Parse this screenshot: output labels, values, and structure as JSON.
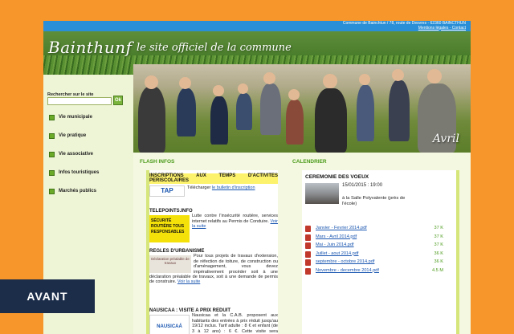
{
  "topbar": {
    "address": "Commune de Bainchtun / 78, route de Desvres - 62360 BAINCTHUN",
    "links": "Mentions légales - Contact"
  },
  "banner": {
    "title": "Bainthunf",
    "subtitle": "le site officiel de la commune"
  },
  "search": {
    "label": "Rechercher sur le site",
    "value": "",
    "button_label": "Ok"
  },
  "nav": {
    "items": [
      {
        "label": "Vie municipale"
      },
      {
        "label": "Vie pratique"
      },
      {
        "label": "Vie associative"
      },
      {
        "label": "Infos touristiques"
      },
      {
        "label": "Marchés publics"
      }
    ]
  },
  "photo": {
    "caption": "Avril"
  },
  "flash": {
    "heading": "FLASH INFOS",
    "items": [
      {
        "title": "INSCRIPTIONS AUX TEMPS D'ACTIVITES PERISCOLAIRES",
        "thumb": "TAP",
        "text": "Télécharger ",
        "link": "le bulletin d'inscription"
      },
      {
        "title": "TELEPOINTS.INFO",
        "thumb": "SÉCURITÉ ROUTIÈRE TOUS RESPONSABLES",
        "text": "Lutte contre l'insécurité routière, services internet relatifs au Permis de Conduire. ",
        "link": "Voir la suite"
      },
      {
        "title": "REGLES D'URBANISME",
        "thumb": "Déclaration préalable de travaux",
        "text": "Pour tous projets de travaux d'extension, de réfection de toiture, de construction ou d'aménagement, vous devez impérativement procéder soit à une déclaration préalable de travaux, soit à une demande de permis de construire. ",
        "link": "Voir la suite"
      },
      {
        "title": "NAUSICAA : VISITE A PRIX REDUIT",
        "thumb": "NAUSICAÁ",
        "text": "Nausicaa et la C.A.B. proposent aux habitants des entrées à prix réduit jusqu'au 19/12 inclus. Tarif adulte : 8 € et enfant (de 3 à 12 ans) : 6 €. Cette visite sera également l'occasion d'apprécier l'exposition \"Histoires",
        "link": ""
      }
    ]
  },
  "calendar": {
    "heading": "CALENDRIER",
    "event": {
      "title": "CEREMONIE DES VOEUX",
      "date": "15/01/2015 : 19:00",
      "location": "à la Salle Polyvalente (près de l'école)"
    },
    "files": [
      {
        "name": "Janvier - Fevrier 2014.pdf",
        "size": "37 K"
      },
      {
        "name": "Mars - Avril 2014.pdf",
        "size": "37 K"
      },
      {
        "name": "Mai - Juin 2014.pdf",
        "size": "37 K"
      },
      {
        "name": "Juillet - aout 2014.pdf",
        "size": "36 K"
      },
      {
        "name": "septembre - octobre 2014.pdf",
        "size": "36 K"
      },
      {
        "name": "Novembre - decembre 2014.pdf",
        "size": "4.5 M"
      }
    ]
  },
  "badge": {
    "label": "AVANT"
  },
  "colors": {
    "page_bg": "#f7962a",
    "topbar": "#2a8fd6",
    "accent_green": "#4a9a1a",
    "badge_bg": "#1c2d4a",
    "link": "#1a56b0",
    "highlight": "#fdf26c"
  },
  "icons": {
    "nav_bullet": "green-square-icon",
    "file": "pdf-icon"
  }
}
